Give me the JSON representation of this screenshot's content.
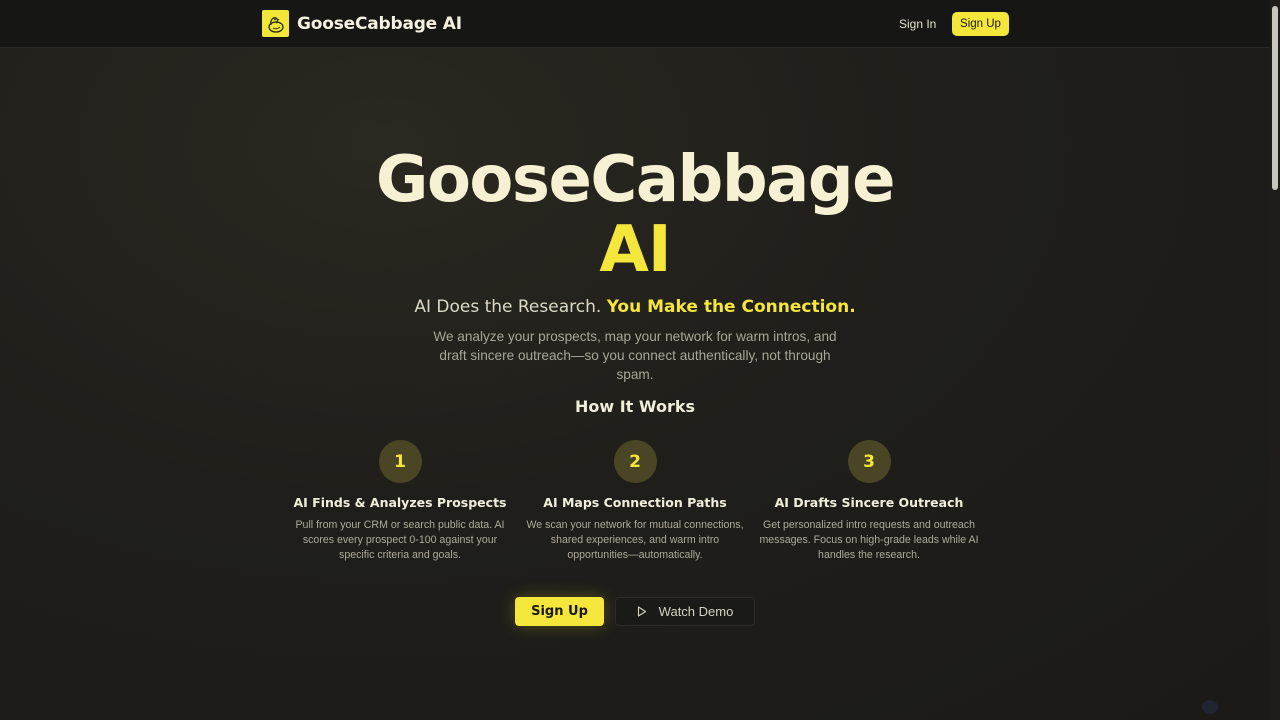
{
  "header": {
    "brand_name": "GooseCabbage AI",
    "logo_icon": "goose-icon",
    "sign_in_label": "Sign In",
    "sign_up_label": "Sign Up"
  },
  "hero": {
    "title_line1": "GooseCabbage",
    "title_line2": "AI",
    "tagline_plain": "AI Does the Research. ",
    "tagline_highlight": "You Make the Connection.",
    "subtitle": "We analyze your prospects, map your network for warm intros, and draft sincere outreach—so you connect authentically, not through spam."
  },
  "how_it_works": {
    "heading": "How It Works",
    "steps": [
      {
        "number": "1",
        "title": "AI Finds & Analyzes Prospects",
        "description": "Pull from your CRM or search public data. AI scores every prospect 0-100 against your specific criteria and goals."
      },
      {
        "number": "2",
        "title": "AI Maps Connection Paths",
        "description": "We scan your network for mutual connections, shared experiences, and warm intro opportunities—automatically."
      },
      {
        "number": "3",
        "title": "AI Drafts Sincere Outreach",
        "description": "Get personalized intro requests and outreach messages. Focus on high-grade leads while AI handles the research."
      }
    ]
  },
  "cta": {
    "sign_up_label": "Sign Up",
    "watch_demo_label": "Watch Demo",
    "play_icon": "play-icon"
  },
  "colors": {
    "accent": "#f5e63b",
    "background": "#1f1e1a",
    "title": "#f6f1d2"
  }
}
